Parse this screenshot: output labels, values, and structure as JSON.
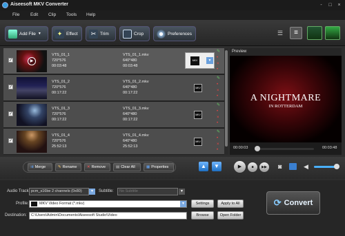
{
  "window": {
    "title": "Aiseesoft MKV Converter",
    "controls": [
      "-",
      "□",
      "×"
    ]
  },
  "menu": [
    "File",
    "Edit",
    "Clip",
    "Tools",
    "Help"
  ],
  "toolbar": {
    "add_file": "Add File",
    "effect": "Effect",
    "trim": "Trim",
    "crop": "Crop",
    "preferences": "Preferences"
  },
  "files": [
    {
      "name": "VTS_01_1",
      "res": "720*576",
      "duration": "00:03:48",
      "out_name": "VTS_01_1.mkv",
      "out_res": "640*480",
      "out_duration": "00:03:48",
      "format": "MKV"
    },
    {
      "name": "VTS_01_2",
      "res": "720*576",
      "duration": "00:17:22",
      "out_name": "VTS_01_2.mkv",
      "out_res": "640*480",
      "out_duration": "00:17:22",
      "format": "MKV"
    },
    {
      "name": "VTS_01_3",
      "res": "720*576",
      "duration": "00:17:22",
      "out_name": "VTS_01_3.mkv",
      "out_res": "640*480",
      "out_duration": "00:17:22",
      "format": "MKV"
    },
    {
      "name": "VTS_01_4",
      "res": "720*576",
      "duration": "25:52:13",
      "out_name": "VTS_01_4.mkv",
      "out_res": "640*480",
      "out_duration": "25:52:13",
      "format": "MKV"
    }
  ],
  "preview": {
    "label": "Preview",
    "title_big": "A NIGHTMARE",
    "title_small": "IN ROTTERDAM",
    "time_current": "00:00:03",
    "time_total": "00:03:48"
  },
  "actions": {
    "merge": "Merge",
    "rename": "Rename",
    "remove": "Remove",
    "clear_all": "Clear All",
    "properties": "Properties"
  },
  "settings": {
    "audio_track_label": "Audio Track:",
    "audio_track_value": "pcm_s16be 2 channels (0x80)",
    "subtitle_label": "Subtitle:",
    "subtitle_value": "No Subtitle",
    "profile_label": "Profile:",
    "profile_value": "MKV Video Format (*.mkv)",
    "destination_label": "Destination:",
    "destination_value": "C:\\Users\\Admin\\Documents\\Aiseesoft Studio\\Video",
    "settings_button": "Settings",
    "apply_all_button": "Apply to All",
    "browse_button": "Browse",
    "open_folder_button": "Open Folder"
  },
  "convert_label": "Convert"
}
